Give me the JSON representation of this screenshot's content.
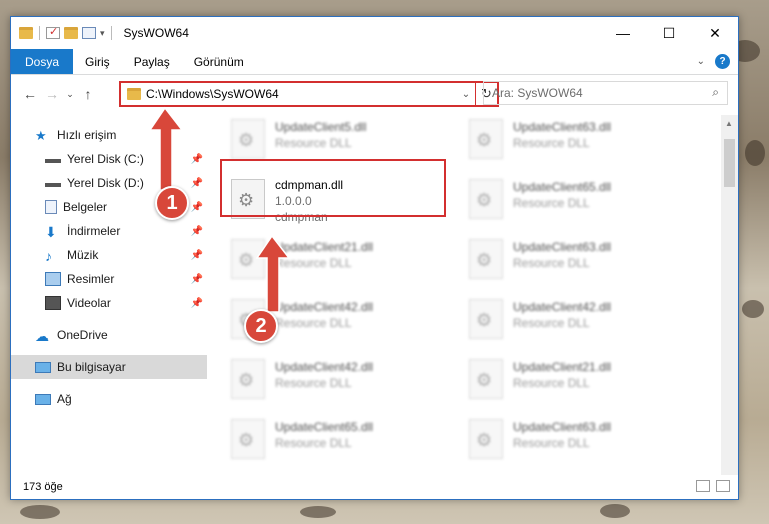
{
  "window": {
    "title": "SysWOW64",
    "controls": {
      "minimize": "—",
      "maximize": "☐",
      "close": "✕"
    }
  },
  "ribbon": {
    "tabs": [
      {
        "label": "Dosya",
        "active": true
      },
      {
        "label": "Giriş"
      },
      {
        "label": "Paylaş"
      },
      {
        "label": "Görünüm"
      }
    ]
  },
  "address": {
    "path": "C:\\Windows\\SysWOW64",
    "search_placeholder": "Ara: SysWOW64"
  },
  "sidebar": {
    "quick_access": "Hızlı erişim",
    "items": [
      {
        "label": "Yerel Disk (C:)",
        "pinned": true
      },
      {
        "label": "Yerel Disk (D:)",
        "pinned": true
      },
      {
        "label": "Belgeler",
        "pinned": true
      },
      {
        "label": "İndirmeler",
        "pinned": true
      },
      {
        "label": "Müzik",
        "pinned": true
      },
      {
        "label": "Resimler",
        "pinned": true
      },
      {
        "label": "Videolar",
        "pinned": true
      }
    ],
    "onedrive": "OneDrive",
    "this_pc": "Bu bilgisayar",
    "network": "Ağ"
  },
  "files": [
    {
      "name": "UpdateClient5.dll",
      "sub": "Resource DLL",
      "blurred": true
    },
    {
      "name": "UpdateClient63.dll",
      "sub": "Resource DLL",
      "blurred": true
    },
    {
      "name": "cdmpman.dll",
      "version": "1.0.0.0",
      "sub": "cdmpman",
      "blurred": false
    },
    {
      "name": "UpdateClient65.dll",
      "sub": "Resource DLL",
      "blurred": true
    },
    {
      "name": "UpdateClient21.dll",
      "sub": "Resource DLL",
      "blurred": true
    },
    {
      "name": "UpdateClient63.dll",
      "sub": "Resource DLL",
      "blurred": true
    },
    {
      "name": "UpdateClient42.dll",
      "sub": "Resource DLL",
      "blurred": true
    },
    {
      "name": "UpdateClient42.dll",
      "sub": "Resource DLL",
      "blurred": true
    },
    {
      "name": "UpdateClient42.dll",
      "sub": "Resource DLL",
      "blurred": true
    },
    {
      "name": "UpdateClient21.dll",
      "sub": "Resource DLL",
      "blurred": true
    },
    {
      "name": "UpdateClient65.dll",
      "sub": "Resource DLL",
      "blurred": true
    },
    {
      "name": "UpdateClient63.dll",
      "sub": "Resource DLL",
      "blurred": true
    }
  ],
  "status": {
    "count": "173 öğe"
  },
  "callouts": [
    "1",
    "2"
  ],
  "colors": {
    "accent": "#1979ca",
    "highlight": "#d32f2f",
    "callout": "#d8473a"
  }
}
